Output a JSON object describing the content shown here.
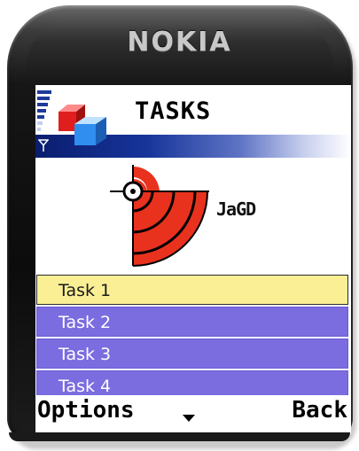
{
  "device": {
    "brand": "NOKIA"
  },
  "header": {
    "title": "TASKS",
    "app_icon": "stacked-cubes-icon",
    "signal_icon": "signal-strength-icon",
    "antenna_icon": "antenna-icon"
  },
  "logo": {
    "icon": "target-logo-icon",
    "text": "JaGD"
  },
  "tasks": {
    "items": [
      {
        "label": "Task 1",
        "selected": true
      },
      {
        "label": "Task 2",
        "selected": false
      },
      {
        "label": "Task 3",
        "selected": false
      },
      {
        "label": "Task 4",
        "selected": false
      }
    ]
  },
  "softkeys": {
    "left_label": "Options",
    "right_label": "Back",
    "center_icon": "scroll-down-icon"
  },
  "colors": {
    "selected_bg": "#fbef96",
    "item_bg": "#7b6ce0",
    "header_band": "#16349a",
    "target_red": "#e8321e"
  }
}
